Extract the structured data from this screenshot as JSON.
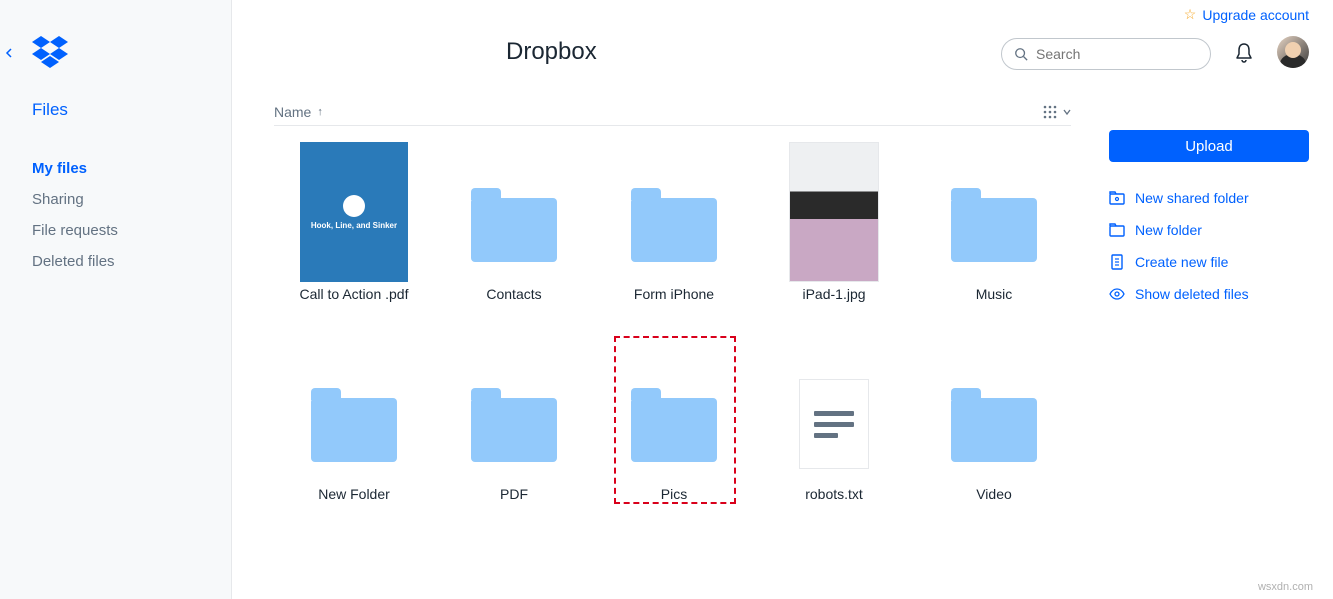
{
  "brand": {
    "accent": "#0061fe"
  },
  "upgrade": {
    "label": "Upgrade account"
  },
  "header": {
    "title": "Dropbox",
    "search_placeholder": "Search"
  },
  "sidebar": {
    "section_label": "Files",
    "items": [
      {
        "label": "My files",
        "active": true
      },
      {
        "label": "Sharing",
        "active": false
      },
      {
        "label": "File requests",
        "active": false
      },
      {
        "label": "Deleted files",
        "active": false
      }
    ]
  },
  "list": {
    "sort_column": "Name",
    "sort_direction": "asc"
  },
  "files": [
    {
      "name": "Call to Action .pdf",
      "kind": "pdf",
      "highlighted": false,
      "pdf_caption": "Hook, Line, and Sinker"
    },
    {
      "name": "Contacts",
      "kind": "folder",
      "highlighted": false
    },
    {
      "name": "Form iPhone",
      "kind": "folder",
      "highlighted": false
    },
    {
      "name": "iPad-1.jpg",
      "kind": "image",
      "highlighted": false
    },
    {
      "name": "Music",
      "kind": "folder",
      "highlighted": false
    },
    {
      "name": "New Folder",
      "kind": "folder",
      "highlighted": false
    },
    {
      "name": "PDF",
      "kind": "folder",
      "highlighted": false
    },
    {
      "name": "Pics",
      "kind": "folder",
      "highlighted": true
    },
    {
      "name": "robots.txt",
      "kind": "text",
      "highlighted": false
    },
    {
      "name": "Video",
      "kind": "folder",
      "highlighted": false
    }
  ],
  "actions": {
    "upload": "Upload",
    "links": [
      {
        "icon": "shared-folder-icon",
        "label": "New shared folder"
      },
      {
        "icon": "folder-outline-icon",
        "label": "New folder"
      },
      {
        "icon": "file-outline-icon",
        "label": "Create new file"
      },
      {
        "icon": "eye-icon",
        "label": "Show deleted files"
      }
    ]
  },
  "watermark": "wsxdn.com"
}
